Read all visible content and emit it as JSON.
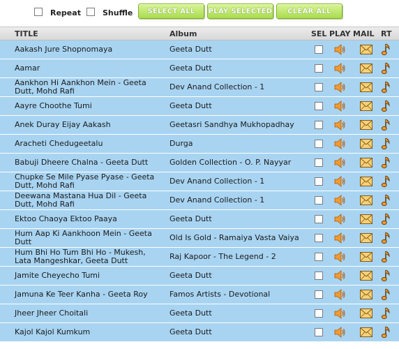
{
  "toolbar": {
    "repeat_label": "Repeat",
    "shuffle_label": "Shuffle",
    "select_all_label": "SELECT ALL",
    "play_selected_label": "PLAY SELECTED",
    "clear_all_label": "CLEAR ALL"
  },
  "columns": {
    "title": "TITLE",
    "album": "Album",
    "sel": "SEL",
    "play": "PLAY",
    "mail": "MAIL",
    "rt": "RT"
  },
  "colors": {
    "row_background": "#a8d4f2",
    "button_green": "#a9dc4d",
    "speaker_orange": "#f29a2e",
    "mail_yellow": "#f5d27a"
  },
  "icons": {
    "play": "speaker-icon",
    "mail": "envelope-icon",
    "rt": "music-note-icon"
  },
  "songs": [
    {
      "title": "Aakash Jure Shopnomaya",
      "album": "Geeta Dutt"
    },
    {
      "title": "Aamar",
      "album": "Geeta Dutt"
    },
    {
      "title": "Aankhon Hi Aankhon Mein - Geeta Dutt, Mohd Rafi",
      "album": "Dev Anand Collection - 1"
    },
    {
      "title": "Aayre Choothe Tumi",
      "album": "Geeta Dutt"
    },
    {
      "title": "Anek Duray Eijay Aakash",
      "album": "Geetasri Sandhya Mukhopadhay"
    },
    {
      "title": "Aracheti Chedugeetalu",
      "album": "Durga"
    },
    {
      "title": "Babuji Dheere Chalna - Geeta Dutt",
      "album": "Golden Collection - O. P. Nayyar"
    },
    {
      "title": "Chupke Se Mile Pyase Pyase - Geeta Dutt, Mohd Rafi",
      "album": "Dev Anand Collection - 1"
    },
    {
      "title": "Deewana Mastana Hua Dil - Geeta Dutt, Mohd Rafi",
      "album": "Dev Anand Collection - 1"
    },
    {
      "title": "Ektoo Chaoya Ektoo Paaya",
      "album": "Geeta Dutt"
    },
    {
      "title": "Hum Aap Ki Aankhoon Mein - Geeta Dutt",
      "album": "Old Is Gold - Ramaiya Vasta Vaiya"
    },
    {
      "title": "Hum Bhi Ho Tum Bhi Ho - Mukesh, Lata Mangeshkar, Geeta Dutt",
      "album": "Raj Kapoor - The Legend - 2"
    },
    {
      "title": "Jamite Cheyecho Tumi",
      "album": "Geeta Dutt"
    },
    {
      "title": "Jamuna Ke Teer Kanha - Geeta Roy",
      "album": "Famos Artists - Devotional"
    },
    {
      "title": "Jheer Jheer Choitali",
      "album": "Geeta Dutt"
    },
    {
      "title": "Kajol Kajol Kumkum",
      "album": "Geeta Dutt"
    }
  ]
}
